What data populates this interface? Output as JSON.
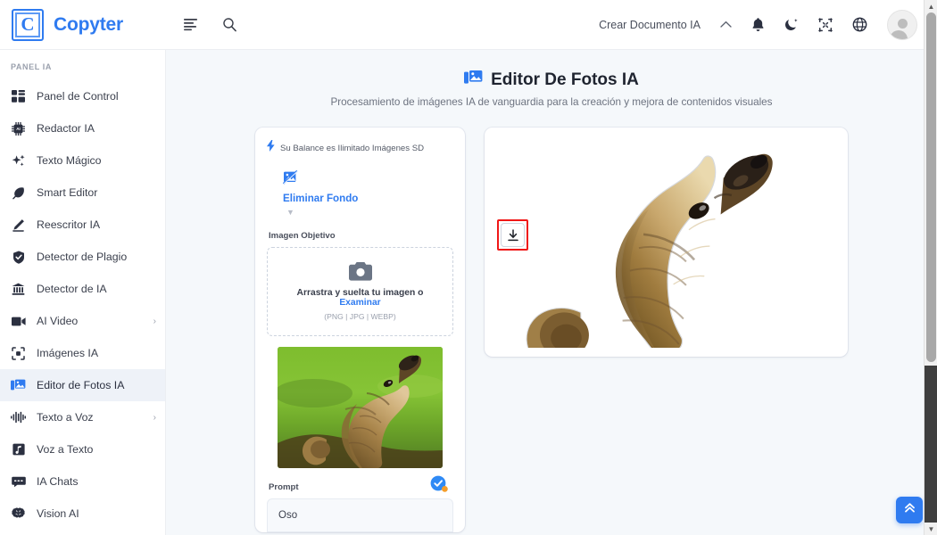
{
  "brand": {
    "logo_letter": "C",
    "name": "Copyter"
  },
  "topbar": {
    "menu_icon": "menu-icon",
    "search_icon": "search-icon",
    "create_document_label": "Crear Documento IA",
    "chevron_icon": "chevron-up-icon",
    "bell_icon": "bell-icon",
    "theme_icon": "moon-icon",
    "fullscreen_icon": "fullscreen-exit-icon",
    "language_icon": "globe-icon",
    "avatar_icon": "user-avatar"
  },
  "sidebar": {
    "section_label": "PANEL IA",
    "items": [
      {
        "label": "Panel de Control",
        "icon": "dashboard-icon",
        "active": false,
        "expandable": false
      },
      {
        "label": "Redactor IA",
        "icon": "chip-ai-icon",
        "active": false,
        "expandable": false
      },
      {
        "label": "Texto Mágico",
        "icon": "sparkles-icon",
        "active": false,
        "expandable": false
      },
      {
        "label": "Smart Editor",
        "icon": "feather-icon",
        "active": false,
        "expandable": false
      },
      {
        "label": "Reescritor IA",
        "icon": "pencil-icon",
        "active": false,
        "expandable": false
      },
      {
        "label": "Detector de Plagio",
        "icon": "shield-check-icon",
        "active": false,
        "expandable": false
      },
      {
        "label": "Detector de IA",
        "icon": "bank-icon",
        "active": false,
        "expandable": false
      },
      {
        "label": "AI Video",
        "icon": "video-icon",
        "active": false,
        "expandable": true
      },
      {
        "label": "Imágenes IA",
        "icon": "image-frame-icon",
        "active": false,
        "expandable": false
      },
      {
        "label": "Editor de Fotos IA",
        "icon": "photo-editor-icon",
        "active": true,
        "expandable": false
      },
      {
        "label": "Texto a Voz",
        "icon": "waveform-icon",
        "active": false,
        "expandable": true
      },
      {
        "label": "Voz a Texto",
        "icon": "music-note-icon",
        "active": false,
        "expandable": false
      },
      {
        "label": "IA Chats",
        "icon": "chat-icon",
        "active": false,
        "expandable": false
      },
      {
        "label": "Vision AI",
        "icon": "brain-icon",
        "active": false,
        "expandable": false
      }
    ]
  },
  "page": {
    "title": "Editor De Fotos IA",
    "title_icon": "photo-editor-icon",
    "subtitle": "Procesamiento de imágenes IA de vanguardia para la creación y mejora de contenidos visuales"
  },
  "left_panel": {
    "balance_icon": "lightning-bolt-icon",
    "balance_text": "Su Balance es Ilimitado Imágenes SD",
    "tab": {
      "label": "Eliminar Fondo",
      "icon": "remove-background-icon",
      "caret_icon": "caret-down-icon"
    },
    "target_image_label": "Imagen Objetivo",
    "dropzone": {
      "icon": "camera-icon",
      "text": "Arrastra y suelta tu imagen o ",
      "browse_link": "Examinar",
      "formats": "(PNG | JPG | WEBP)"
    },
    "thumbnail_alt": "bear-original-photo",
    "prompt_label": "Prompt",
    "prompt_value": "Oso",
    "verified_badge_icon": "verified-check-icon"
  },
  "right_panel": {
    "result_alt": "bear-background-removed",
    "download_icon": "download-icon"
  },
  "scroll_top": {
    "icon": "double-chevron-up-icon"
  },
  "colors": {
    "accent": "#2f7bf0",
    "highlight_box": "#f01717",
    "main_bg": "#f5f8fb",
    "active_nav_bg": "#eef2f8",
    "text_primary": "#2b3040",
    "text_muted": "#6d7380"
  }
}
